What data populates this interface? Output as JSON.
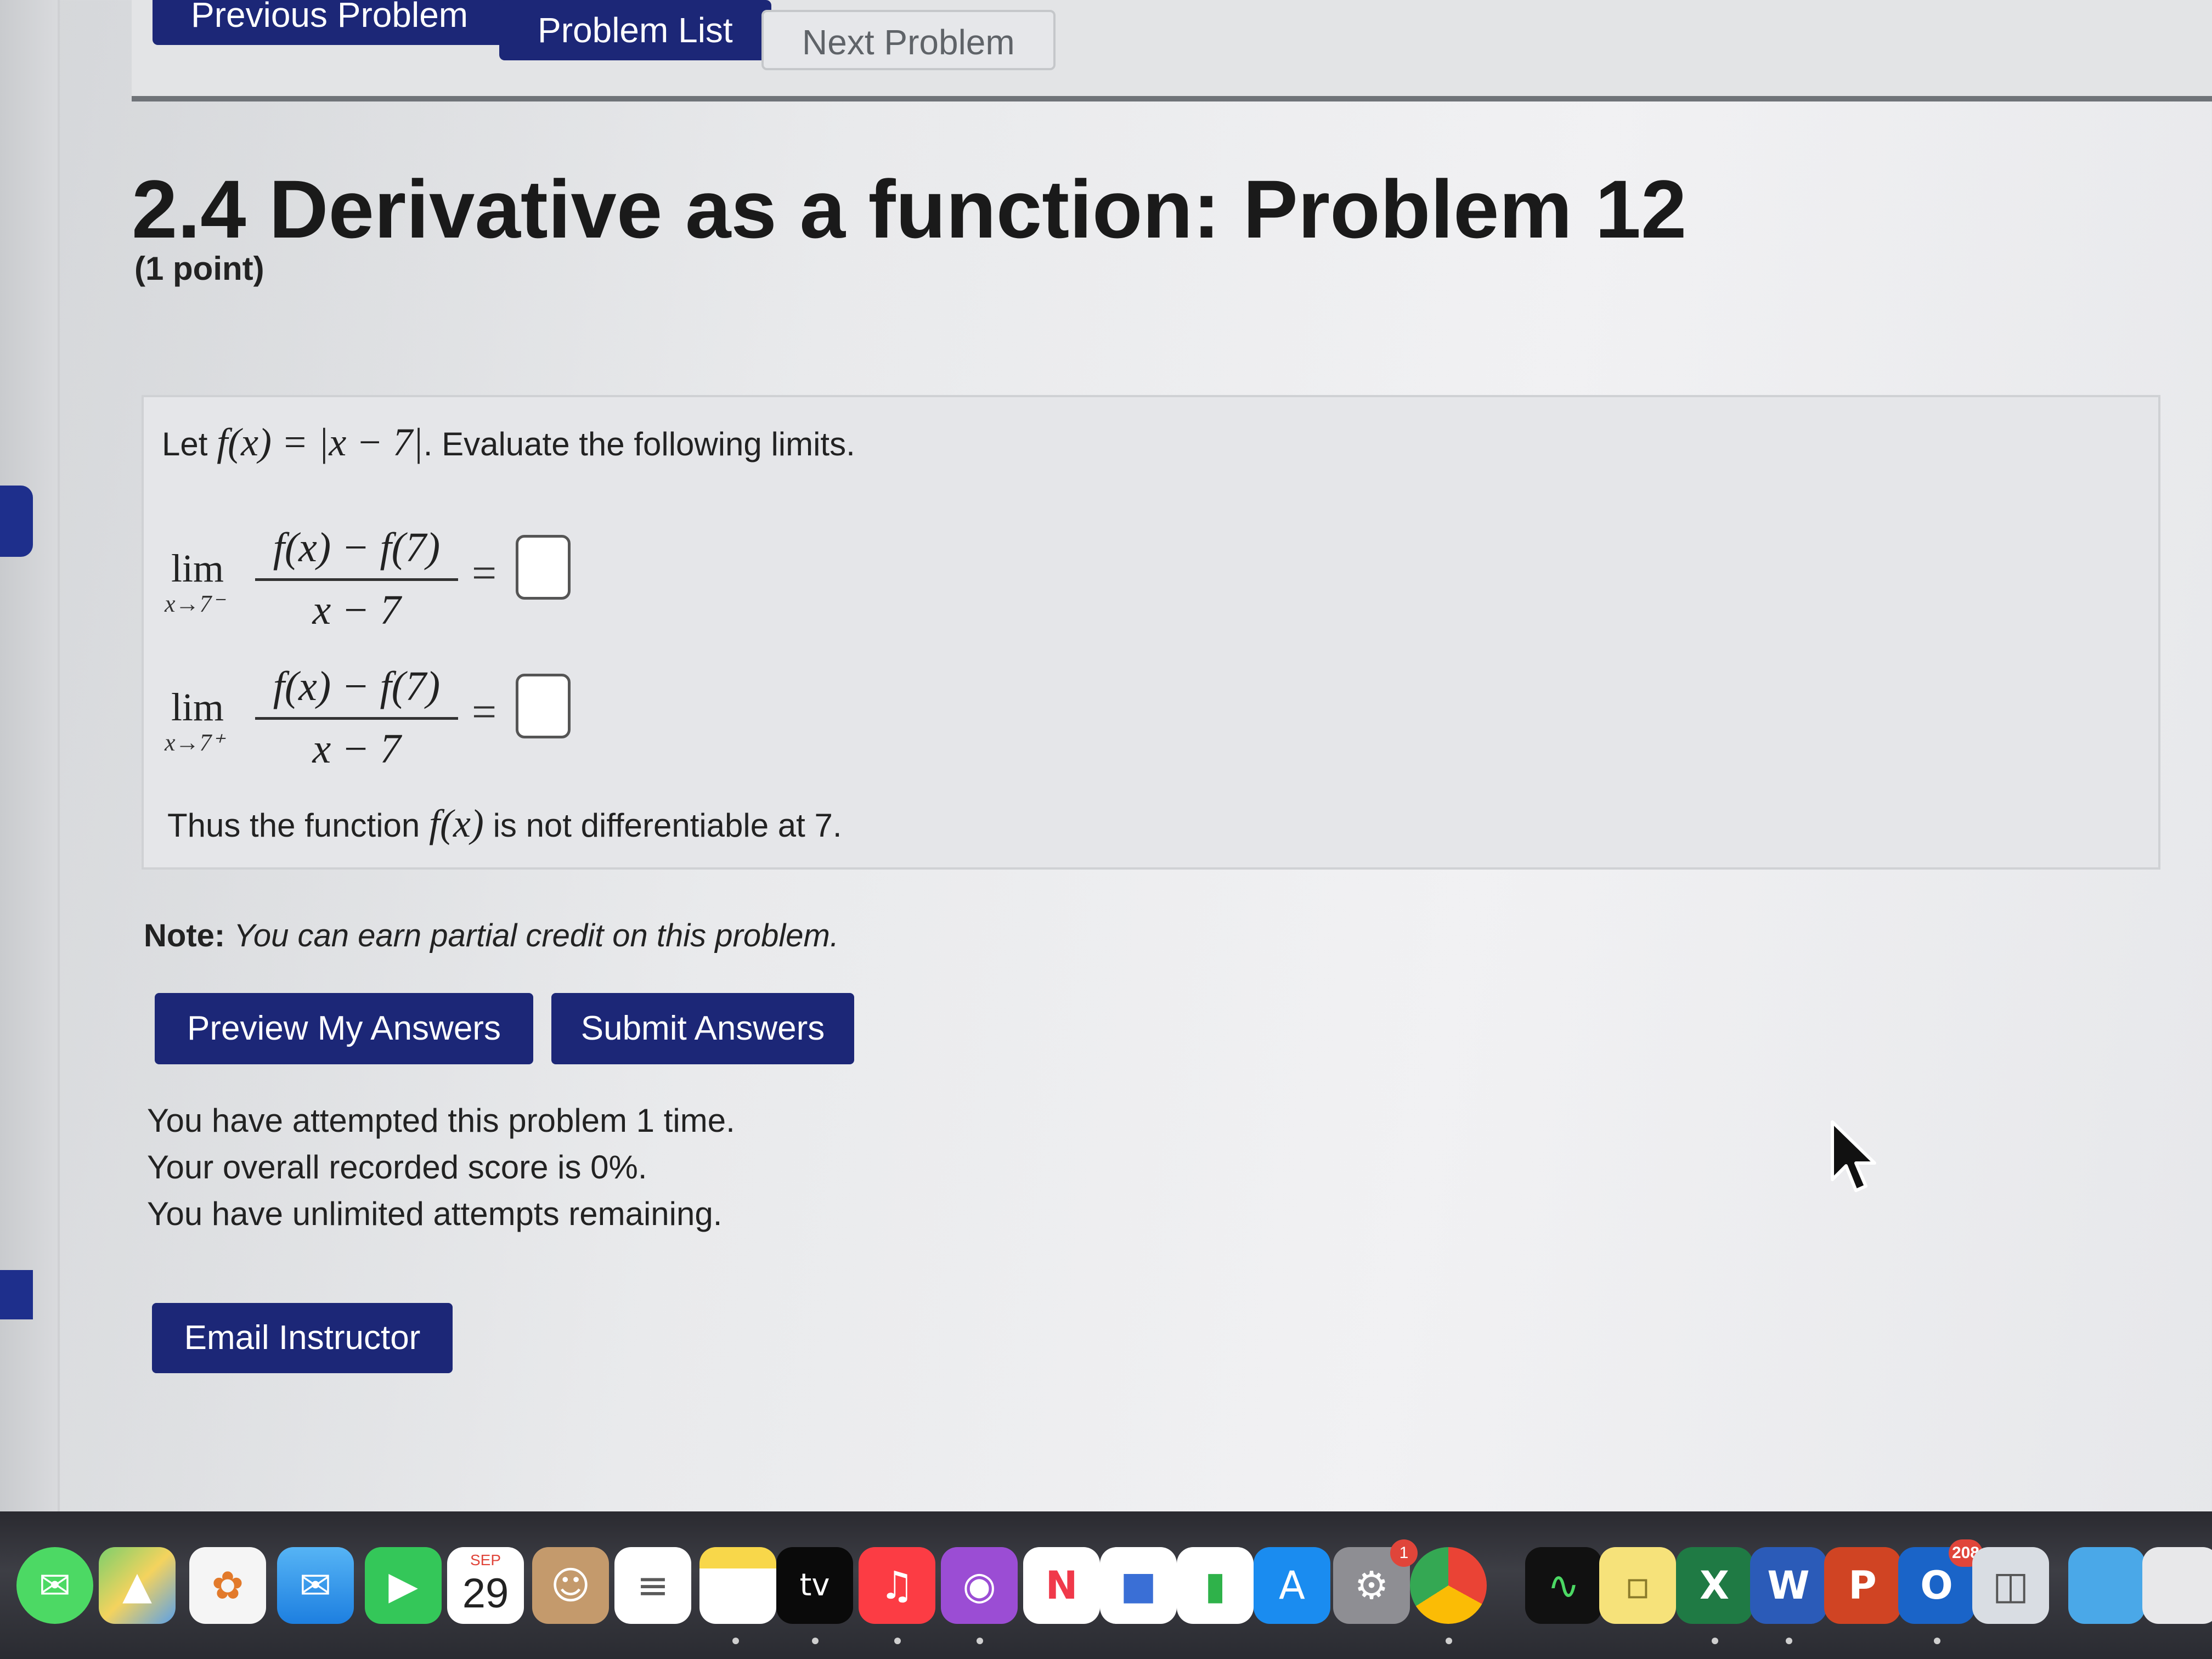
{
  "nav": {
    "previous": "Previous Problem",
    "list": "Problem List",
    "next": "Next Problem"
  },
  "problem": {
    "title": "2.4 Derivative as a function: Problem 12",
    "points": "(1 point)",
    "intro_let": "Let",
    "intro_function": "f(x) = |x − 7|",
    "intro_rest": ". Evaluate the following limits.",
    "limits": [
      {
        "lim_label": "lim",
        "approach": "x→7⁻",
        "numerator": "f(x) − f(7)",
        "denominator": "x − 7",
        "equals": "=",
        "answer": ""
      },
      {
        "lim_label": "lim",
        "approach": "x→7⁺",
        "numerator": "f(x) − f(7)",
        "denominator": "x − 7",
        "equals": "=",
        "answer": ""
      }
    ],
    "thus_prefix": "Thus the function",
    "thus_function": "f(x)",
    "thus_suffix": "is not differentiable at 7."
  },
  "note": {
    "label": "Note:",
    "text": "You can earn partial credit on this problem."
  },
  "buttons": {
    "preview": "Preview My Answers",
    "submit": "Submit Answers",
    "email": "Email Instructor"
  },
  "status": {
    "attempts": "You have attempted this problem 1 time.",
    "score": "Your overall recorded score is 0%.",
    "remaining": "You have unlimited attempts remaining."
  },
  "dock": {
    "calendar_month": "SEP",
    "calendar_day": "29",
    "tv_label": "tv",
    "settings_badge": "1",
    "outlook_badge": "208",
    "icons": [
      "messages-icon",
      "maps-icon",
      "photos-icon",
      "mail-icon",
      "facetime-icon",
      "calendar-icon",
      "contacts-icon",
      "reminders-icon",
      "notes-icon",
      "apple-tv-icon",
      "music-icon",
      "podcasts-icon",
      "news-icon",
      "keynote-icon",
      "numbers-icon",
      "app-store-icon",
      "system-settings-icon",
      "chrome-icon",
      "activity-monitor-icon",
      "stickies-icon",
      "excel-icon",
      "word-icon",
      "powerpoint-icon",
      "outlook-icon",
      "preview-icon",
      "folder-icon",
      "documents-icon"
    ],
    "colors": {
      "nav_dark": "#1c2777",
      "button": "#1c2777",
      "accent_tab": "#1e2f8c"
    }
  }
}
